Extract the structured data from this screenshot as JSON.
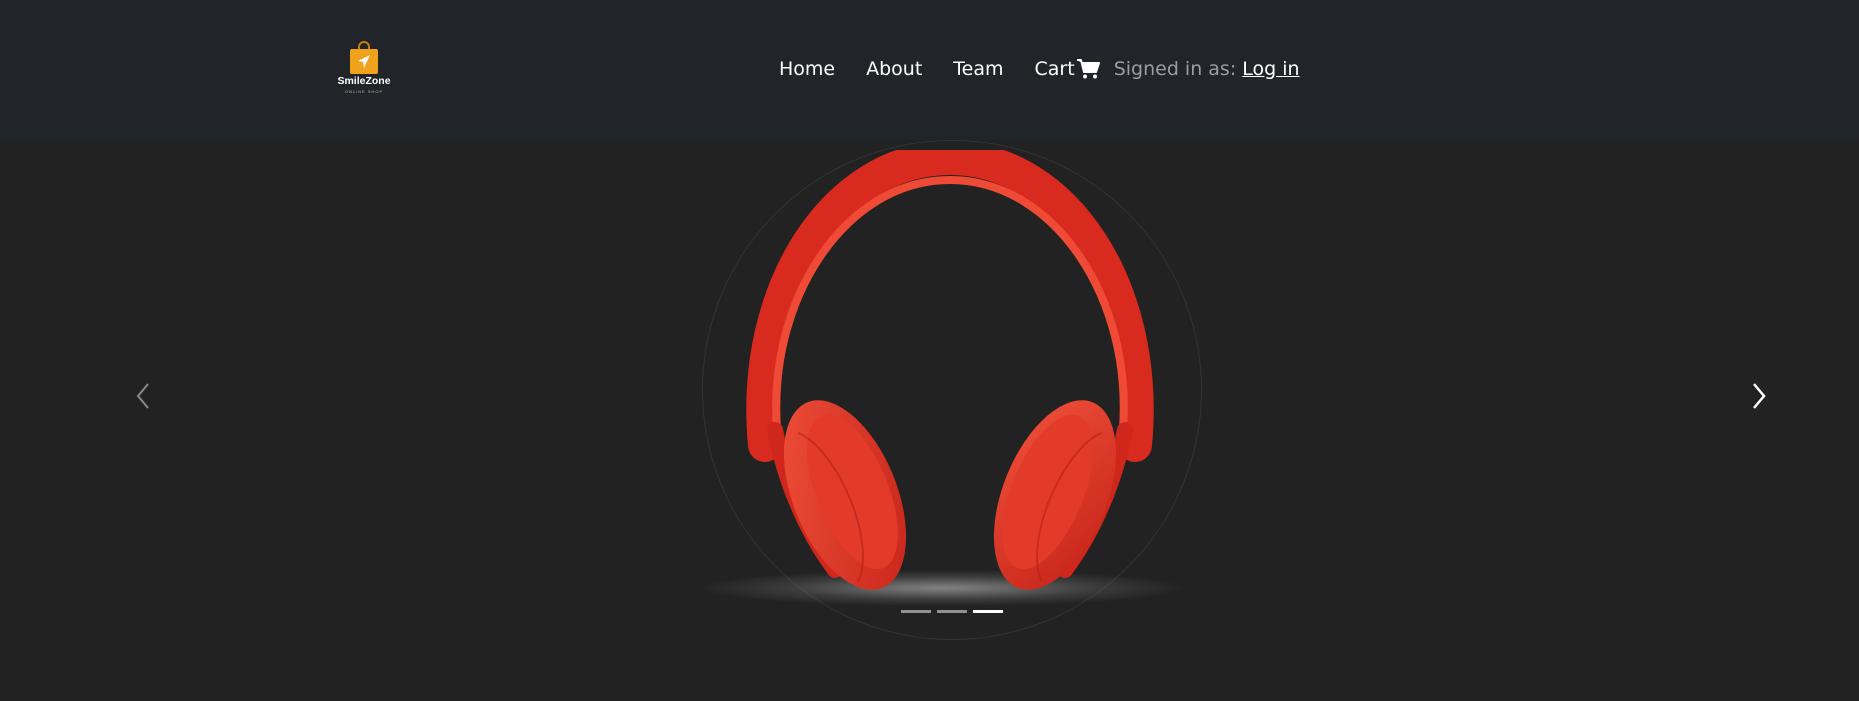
{
  "brand": {
    "name": "SmileZone",
    "tagline": "ONLINE SHOP",
    "accent": "#f0a21c"
  },
  "nav": {
    "items": [
      {
        "label": "Home"
      },
      {
        "label": "About"
      },
      {
        "label": "Team"
      }
    ],
    "cart": {
      "label": "Cart",
      "icon": "cart-icon"
    },
    "signed_in_label": "Signed in as:",
    "login_label": "Log in"
  },
  "carousel": {
    "slide_count": 3,
    "active_index": 2,
    "product_color": "#e63a2b",
    "prev_icon": "chevron-left-icon",
    "next_icon": "chevron-right-icon"
  }
}
